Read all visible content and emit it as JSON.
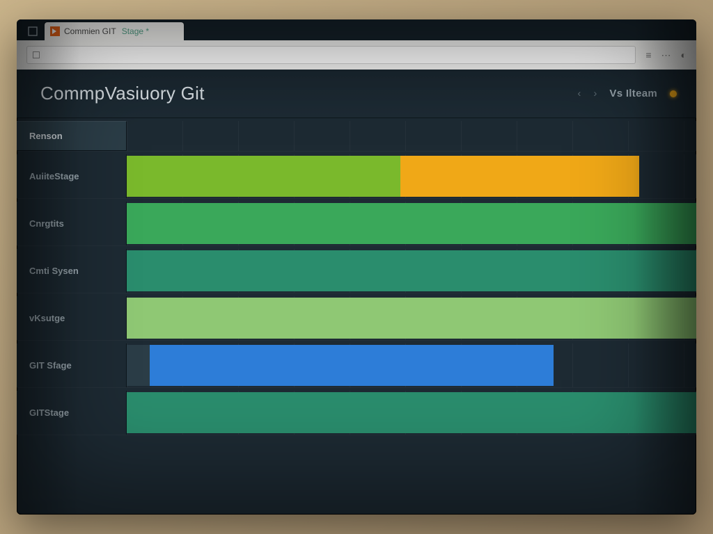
{
  "browser": {
    "tab_title": "Commien GIT",
    "tab_suffix": "Stage *",
    "address_text": "",
    "status_label": ""
  },
  "header": {
    "title": "CommpVasiuory Git",
    "right_label": "Vs Ilteam",
    "nav_prev_icon": "chevron-left",
    "nav_next_icon": "chevron-right",
    "indicator_icon": "status-dot"
  },
  "colors": {
    "green1": "#7ab92c",
    "green2": "#3aa85a",
    "green3": "#8fc874",
    "teal": "#2a8d6d",
    "amber": "#f0a817",
    "blue": "#2d7dd8",
    "panel": "#2b3d47"
  },
  "chart_data": {
    "type": "bar",
    "orientation": "horizontal-stacked",
    "title": "CommpVasiuory Git",
    "xlabel": "",
    "ylabel": "",
    "xlim": [
      0,
      100
    ],
    "header_row_label": "Renson",
    "categories": [
      "AuiiteStage",
      "Cnrgtits",
      "Cmti Sysen",
      "vKsutge",
      "GIT Sfage",
      "GITStage"
    ],
    "series_colors": {
      "green1": "#7ab92c",
      "green2": "#3aa85a",
      "green3": "#8fc874",
      "teal": "#2a8d6d",
      "amber": "#f0a817",
      "blue": "#2d7dd8",
      "panel": "#2b3d47"
    },
    "rows": [
      {
        "label": "AuiiteStage",
        "segments": [
          {
            "start": 0,
            "end": 48,
            "color": "green1"
          },
          {
            "start": 48,
            "end": 90,
            "color": "amber"
          }
        ]
      },
      {
        "label": "Cnrgtits",
        "segments": [
          {
            "start": 0,
            "end": 100,
            "color": "green2"
          }
        ]
      },
      {
        "label": "Cmti Sysen",
        "segments": [
          {
            "start": 0,
            "end": 100,
            "color": "teal"
          }
        ]
      },
      {
        "label": "vKsutge",
        "segments": [
          {
            "start": 0,
            "end": 100,
            "color": "green3"
          }
        ]
      },
      {
        "label": "GIT Sfage",
        "segments": [
          {
            "start": 0,
            "end": 4,
            "color": "panel"
          },
          {
            "start": 4,
            "end": 72,
            "color": "blue",
            "striped": true
          },
          {
            "start": 72,
            "end": 75,
            "color": "blue"
          }
        ]
      },
      {
        "label": "GITStage",
        "segments": [
          {
            "start": 0,
            "end": 100,
            "color": "teal"
          }
        ]
      }
    ]
  }
}
